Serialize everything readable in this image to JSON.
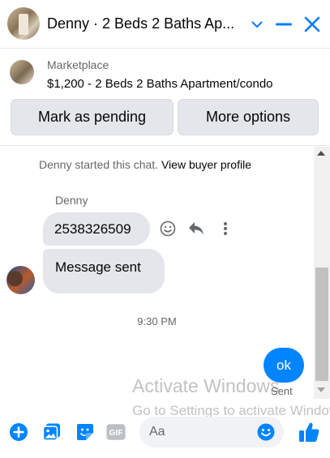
{
  "header": {
    "title": "Denny · 2 Beds 2 Baths Ap...",
    "icons": [
      "chevron-down-icon",
      "minimize-icon",
      "close-icon"
    ]
  },
  "marketplace": {
    "label": "Marketplace",
    "listing": "$1,200 - 2 Beds 2 Baths Apartment/condo",
    "buttons": {
      "pending": "Mark as pending",
      "more": "More options"
    }
  },
  "chat": {
    "started_prefix": "Denny started this chat.",
    "started_link": "View buyer profile",
    "sender_name": "Denny",
    "messages": [
      {
        "text": "2538326509"
      },
      {
        "text": "Message sent"
      }
    ],
    "timestamp": "9:30 PM",
    "outgoing": {
      "text": "ok",
      "status": "Sent"
    }
  },
  "watermark": {
    "line1": "Activate Windows",
    "line2": "Go to Settings to activate Windows."
  },
  "composer": {
    "placeholder": "Aa",
    "gif_label": "GIF"
  },
  "colors": {
    "accent": "#0084ff",
    "bubble_gray": "#e4e6eb"
  }
}
